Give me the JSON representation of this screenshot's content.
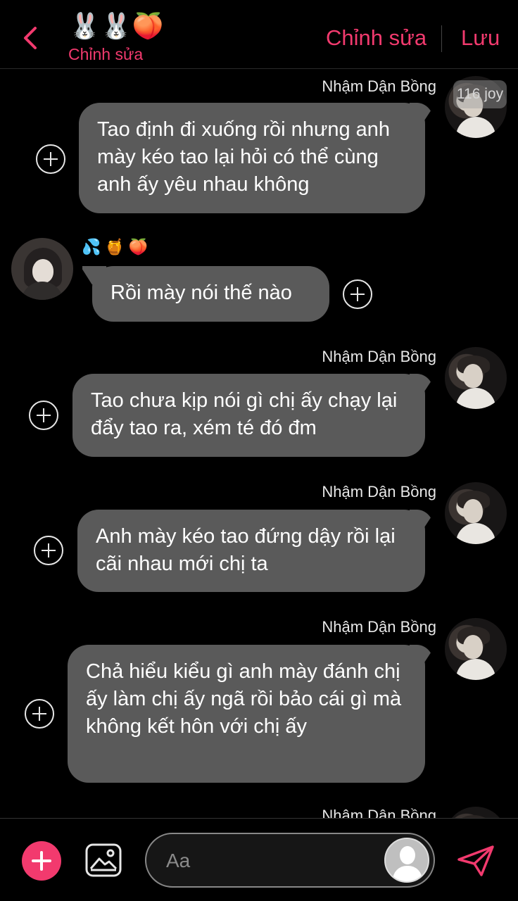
{
  "header": {
    "emojis": "🐰🐰🍑",
    "subtitle": "Chỉnh sửa",
    "edit_label": "Chỉnh sửa",
    "save_label": "Lưu",
    "accent": "#f23a6e"
  },
  "watermark": "116 joy",
  "messages": [
    {
      "sender": "Nhậm Dận Bồng",
      "text": "Tao định đi xuống rồi nhưng anh mày kéo tao lại hỏi có thể cùng anh ấy yêu nhau không"
    },
    {
      "reactions": "💦🍯🍑",
      "text": "Rồi mày nói thế nào"
    },
    {
      "sender": "Nhậm Dận Bồng",
      "text": "Tao chưa kịp nói gì chị ấy chạy lại đẩy tao ra, xém té đó đm"
    },
    {
      "sender": "Nhậm Dận Bồng",
      "text": "Anh mày kéo tao đứng dậy rồi lại cãi nhau mới chị ta"
    },
    {
      "sender": "Nhậm Dận Bồng",
      "text": "Chả hiểu kiểu gì anh mày đánh chị ấy làm chị ấy ngã rồi bảo cái gì mà không kết hôn với chị ấy"
    },
    {
      "sender": "Nhậm Dận Bồng"
    }
  ],
  "composer": {
    "placeholder": "Aa",
    "icons": [
      "add-icon",
      "image-icon",
      "avatar-icon",
      "send-icon"
    ]
  }
}
